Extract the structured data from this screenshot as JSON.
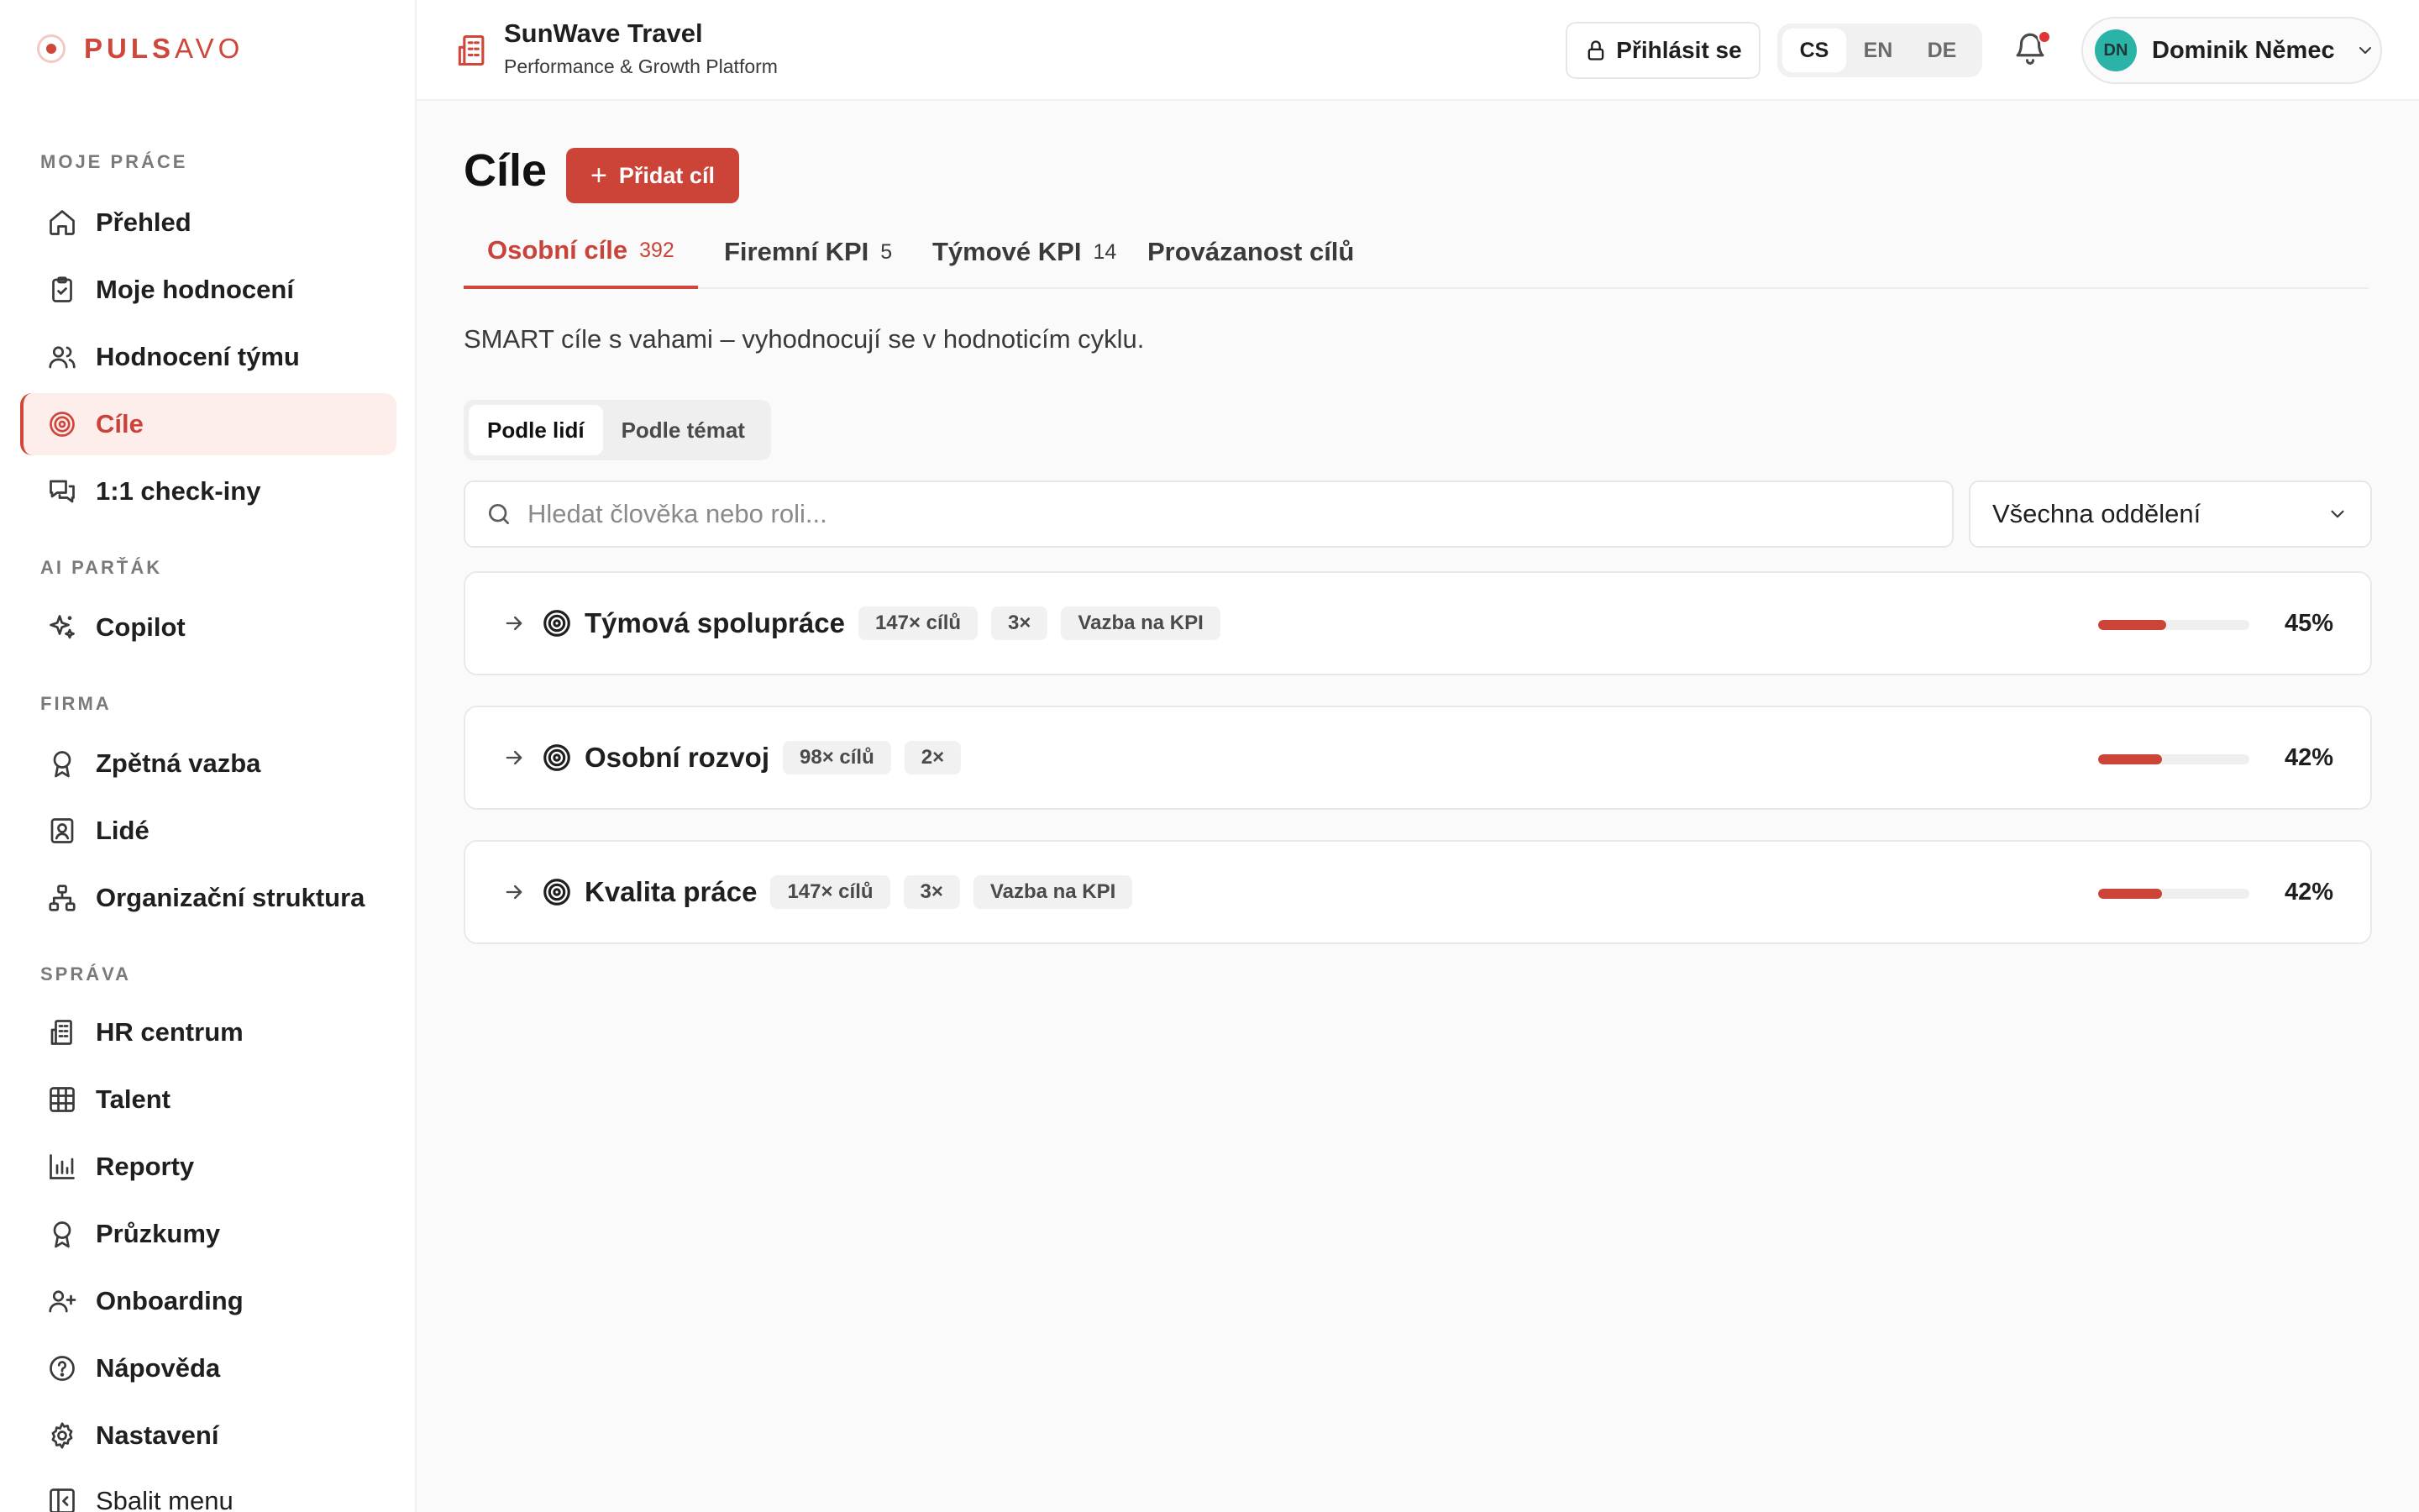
{
  "logo": {
    "text_bold": "PULS",
    "text_light": "AVO"
  },
  "sidebar": {
    "sections": [
      {
        "title": "MOJE PRÁCE",
        "items": [
          {
            "label": "Přehled",
            "icon": "home-icon"
          },
          {
            "label": "Moje hodnocení",
            "icon": "clipboard-icon"
          },
          {
            "label": "Hodnocení týmu",
            "icon": "users-icon"
          },
          {
            "label": "Cíle",
            "icon": "target-icon",
            "active": true
          },
          {
            "label": "1:1 check-iny",
            "icon": "chat-icon"
          }
        ]
      },
      {
        "title": "AI PARŤÁK",
        "items": [
          {
            "label": "Copilot",
            "icon": "sparkles-icon"
          }
        ]
      },
      {
        "title": "FIRMA",
        "items": [
          {
            "label": "Zpětná vazba",
            "icon": "award-icon"
          },
          {
            "label": "Lidé",
            "icon": "contact-icon"
          },
          {
            "label": "Organizační struktura",
            "icon": "network-icon"
          }
        ]
      },
      {
        "title": "SPRÁVA",
        "items": [
          {
            "label": "HR centrum",
            "icon": "building-icon"
          },
          {
            "label": "Talent",
            "icon": "grid-icon"
          },
          {
            "label": "Reporty",
            "icon": "bar-chart-icon"
          },
          {
            "label": "Průzkumy",
            "icon": "award-icon"
          },
          {
            "label": "Onboarding",
            "icon": "user-plus-icon"
          },
          {
            "label": "Nápověda",
            "icon": "help-circle-icon"
          },
          {
            "label": "Nastavení",
            "icon": "gear-icon"
          }
        ]
      }
    ],
    "collapse_label": "Sbalit menu"
  },
  "header": {
    "org_name": "SunWave Travel",
    "org_subtitle": "Performance & Growth Platform",
    "login_label": "Přihlásit se",
    "languages": [
      "CS",
      "EN",
      "DE"
    ],
    "active_language": "CS",
    "user_initials": "DN",
    "user_name": "Dominik Němec"
  },
  "main": {
    "title": "Cíle",
    "add_button": "Přidat cíl",
    "tabs": [
      {
        "label": "Osobní cíle",
        "count": "392",
        "active": true
      },
      {
        "label": "Firemní KPI",
        "count": "5"
      },
      {
        "label": "Týmové KPI",
        "count": "14"
      },
      {
        "label": "Provázanost cílů",
        "count": ""
      }
    ],
    "subtitle": "SMART cíle s vahami – vyhodnocují se v hodnoticím cyklu.",
    "view_toggle": [
      "Podle lidí",
      "Podle témat"
    ],
    "search_placeholder": "Hledat člověka nebo roli...",
    "department_filter": "Všechna oddělení",
    "goal_groups": [
      {
        "name": "Týmová spolupráce",
        "badges": [
          "147× cílů",
          "3×",
          "Vazba na KPI"
        ],
        "progress": 45,
        "progress_label": "45%"
      },
      {
        "name": "Osobní rozvoj",
        "badges": [
          "98× cílů",
          "2×"
        ],
        "progress": 42,
        "progress_label": "42%"
      },
      {
        "name": "Kvalita práce",
        "badges": [
          "147× cílů",
          "3×",
          "Vazba na KPI"
        ],
        "progress": 42,
        "progress_label": "42%"
      }
    ]
  },
  "colors": {
    "accent": "#cc4437",
    "accent_soft": "#fdeeec",
    "avatar": "#2bb3a8",
    "notification": "#e03535"
  }
}
